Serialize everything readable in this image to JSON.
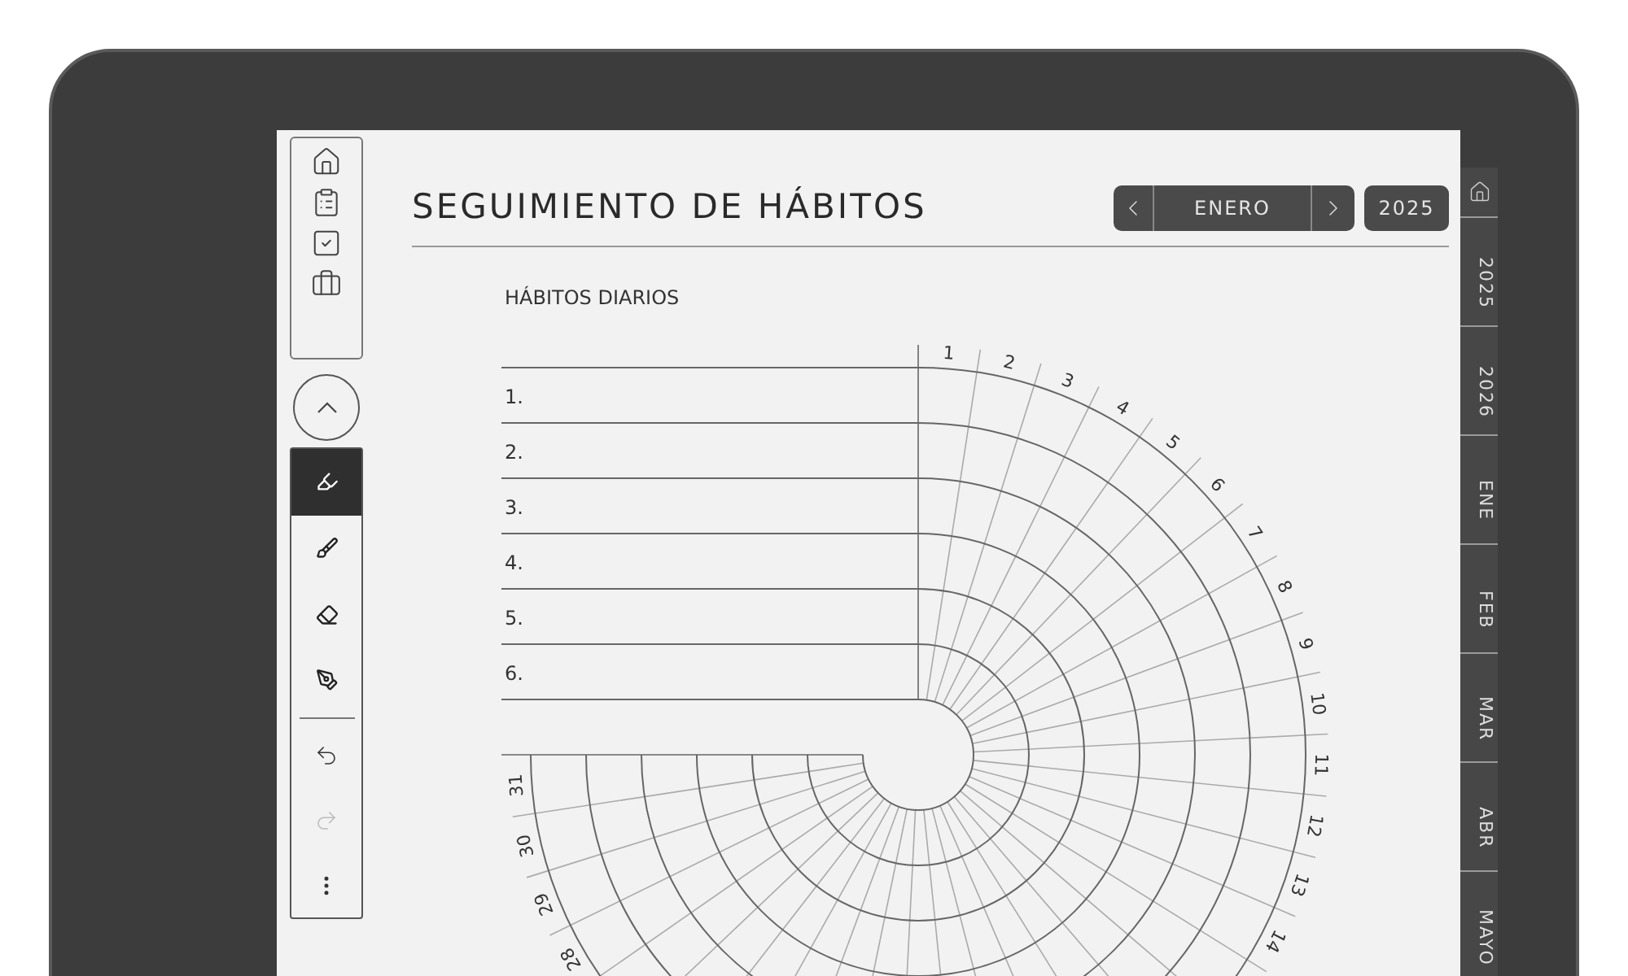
{
  "title": "SEGUIMIENTO DE HÁBITOS",
  "month_nav": {
    "month": "ENERO",
    "year": "2025"
  },
  "section_label": "HÁBITOS DIARIOS",
  "habits": [
    "1.",
    "2.",
    "3.",
    "4.",
    "5.",
    "6."
  ],
  "days_start": [
    "1",
    "2",
    "3",
    "4",
    "5",
    "6",
    "7",
    "8",
    "9",
    "10",
    "11",
    "12",
    "13",
    "14"
  ],
  "days_end": [
    "28",
    "29",
    "30",
    "31"
  ],
  "nav_icons": [
    {
      "kind": "home"
    },
    {
      "kind": "clipboard"
    },
    {
      "kind": "checkbox"
    },
    {
      "kind": "briefcase"
    }
  ],
  "tools": [
    {
      "kind": "highlighter",
      "selected": true
    },
    {
      "kind": "marker",
      "selected": false
    },
    {
      "kind": "eraser",
      "selected": false
    },
    {
      "kind": "pen",
      "selected": false
    }
  ],
  "history": [
    {
      "kind": "undo",
      "disabled": false
    },
    {
      "kind": "redo",
      "disabled": true
    }
  ],
  "side_tabs": [
    {
      "kind": "home"
    },
    {
      "kind": "text",
      "label": "2025"
    },
    {
      "kind": "text",
      "label": "2026"
    },
    {
      "kind": "text",
      "label": "ENE"
    },
    {
      "kind": "text",
      "label": "FEB"
    },
    {
      "kind": "text",
      "label": "MAR"
    },
    {
      "kind": "text",
      "label": "ABR"
    },
    {
      "kind": "text",
      "label": "MAYO"
    }
  ]
}
